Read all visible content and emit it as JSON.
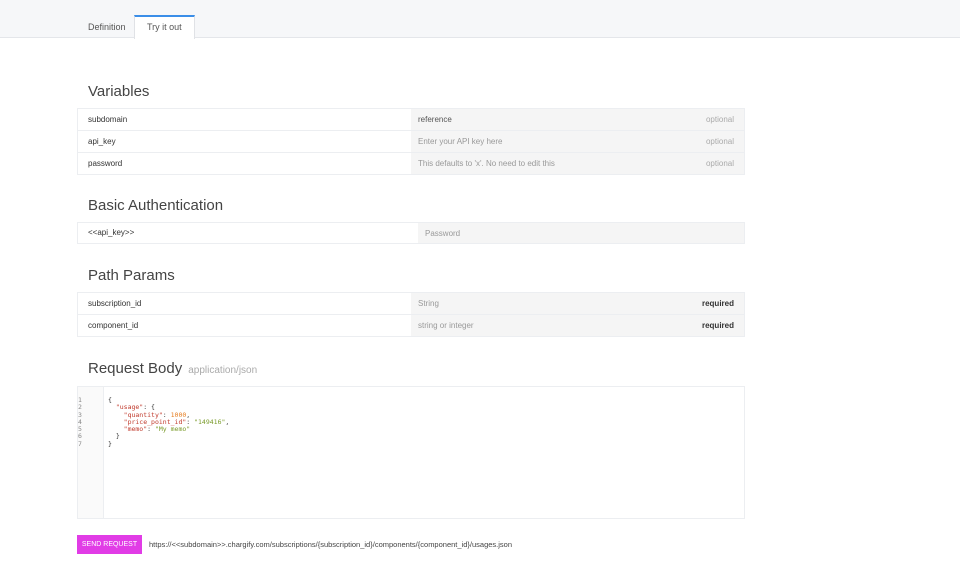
{
  "tabs": {
    "definition": "Definition",
    "try_it_out": "Try it out"
  },
  "variables": {
    "title": "Variables",
    "rows": [
      {
        "name": "subdomain",
        "value": "reference",
        "placeholder": "",
        "tag": "optional"
      },
      {
        "name": "api_key",
        "value": "",
        "placeholder": "Enter your API key here",
        "tag": "optional"
      },
      {
        "name": "password",
        "value": "",
        "placeholder": "This defaults to 'x'. No need to edit this",
        "tag": "optional"
      }
    ]
  },
  "basic_auth": {
    "title": "Basic Authentication",
    "username": "<<api_key>>",
    "password_placeholder": "Password"
  },
  "path_params": {
    "title": "Path Params",
    "rows": [
      {
        "name": "subscription_id",
        "placeholder": "String",
        "tag": "required"
      },
      {
        "name": "component_id",
        "placeholder": "string or integer",
        "tag": "required"
      }
    ]
  },
  "request_body": {
    "title": "Request Body",
    "content_type": "application/json",
    "line_numbers": [
      "1",
      "2",
      "3",
      "4",
      "5",
      "6",
      "7"
    ],
    "code": {
      "l1": "{",
      "l2_key": "\"usage\"",
      "l2_rest": ": {",
      "l3_key": "\"quantity\"",
      "l3_num": "1000",
      "l4_key": "\"price_point_id\"",
      "l4_str": "\"149416\"",
      "l5_key": "\"memo\"",
      "l5_str": "\"My memo\"",
      "l6": "}",
      "l7": "}"
    }
  },
  "send_button": "SEND REQUEST",
  "request_url": "https://<<subdomain>>.chargify.com/subscriptions/{subscription_id}/components/{component_id}/usages.json",
  "colors": {
    "accent": "#e13ce6",
    "tab_active": "#3b8ee8"
  }
}
